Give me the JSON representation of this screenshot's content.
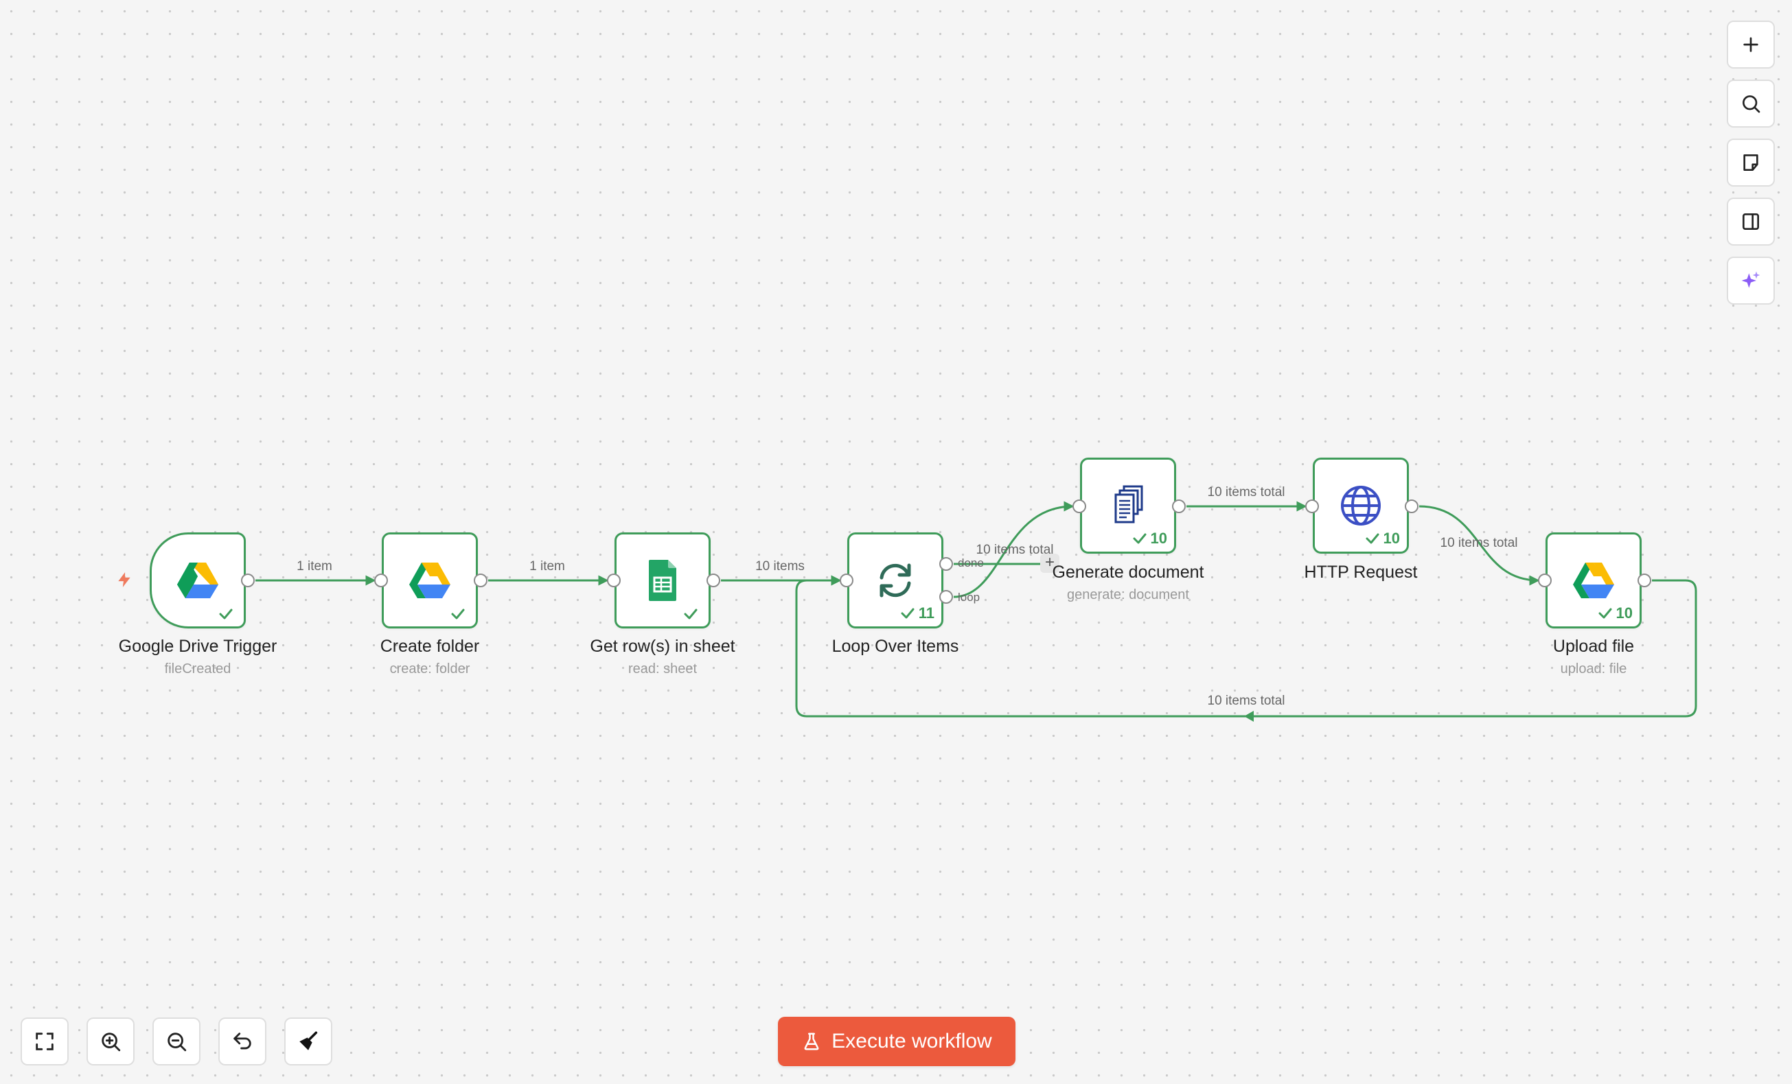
{
  "nodes": [
    {
      "id": "gdrive-trigger",
      "title": "Google Drive Trigger",
      "subtitle": "fileCreated",
      "icon": "google-drive-icon",
      "status": "",
      "kind": "trigger"
    },
    {
      "id": "create-folder",
      "title": "Create folder",
      "subtitle": "create: folder",
      "icon": "google-drive-icon",
      "status": ""
    },
    {
      "id": "get-rows",
      "title": "Get row(s) in sheet",
      "subtitle": "read: sheet",
      "icon": "google-sheets-icon",
      "status": ""
    },
    {
      "id": "loop",
      "title": "Loop Over Items",
      "subtitle": "",
      "icon": "loop-icon",
      "status": "11"
    },
    {
      "id": "generate-doc",
      "title": "Generate document",
      "subtitle": "generate: document",
      "icon": "documents-icon",
      "status": "10"
    },
    {
      "id": "http-request",
      "title": "HTTP Request",
      "subtitle": "",
      "icon": "globe-icon",
      "status": "10"
    },
    {
      "id": "upload-file",
      "title": "Upload file",
      "subtitle": "upload: file",
      "icon": "google-drive-icon",
      "status": "10"
    }
  ],
  "edge_labels": {
    "trigger_to_folder": "1 item",
    "folder_to_rows": "1 item",
    "rows_to_loop": "10 items",
    "loop_to_generate": "10 items total",
    "generate_to_http": "10 items total",
    "http_to_upload": "10 items total",
    "upload_to_loop": "10 items total"
  },
  "ports": {
    "done": "done",
    "loop": "loop"
  },
  "add_node_glyph": "+",
  "right_toolbar": [
    {
      "name": "add-node-button",
      "icon": "plus-icon"
    },
    {
      "name": "search-button",
      "icon": "search-icon"
    },
    {
      "name": "sticky-note-button",
      "icon": "sticky-note-icon"
    },
    {
      "name": "toggle-panel-button",
      "icon": "panel-icon"
    },
    {
      "name": "ai-assistant-button",
      "icon": "sparkle-icon"
    }
  ],
  "bottom_toolbar": [
    {
      "name": "fit-view-button",
      "icon": "fit-view-icon"
    },
    {
      "name": "zoom-in-button",
      "icon": "zoom-in-icon"
    },
    {
      "name": "zoom-out-button",
      "icon": "zoom-out-icon"
    },
    {
      "name": "undo-button",
      "icon": "undo-icon"
    },
    {
      "name": "tidy-up-button",
      "icon": "broom-icon"
    }
  ],
  "execute_button": {
    "label": "Execute workflow",
    "icon": "flask-icon"
  },
  "colors": {
    "success": "#3f9c5a",
    "accent": "#ec5a3d",
    "edge": "#3f9c5a",
    "ai": "#8b5cf6"
  }
}
